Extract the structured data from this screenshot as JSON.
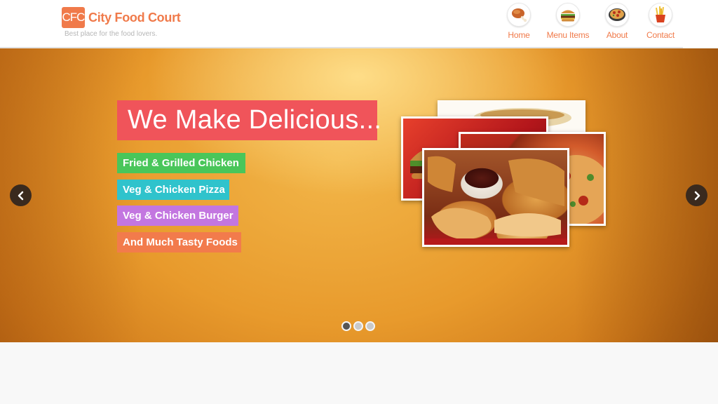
{
  "brand": {
    "logo_mark": "CFC",
    "name": "City Food Court",
    "tagline": "Best place for the food lovers."
  },
  "nav": {
    "items": [
      {
        "label": "Home",
        "icon": "chicken-leg-icon"
      },
      {
        "label": "Menu Items",
        "icon": "burger-icon"
      },
      {
        "label": "About",
        "icon": "pizza-icon"
      },
      {
        "label": "Contact",
        "icon": "fries-icon"
      }
    ]
  },
  "hero": {
    "headline": "We Make Delicious...",
    "tags": [
      "Fried & Grilled Chicken",
      "Veg & Chicken Pizza",
      "Veg & Chicken Burger",
      "And Much Tasty Foods"
    ],
    "slide_count": 3,
    "active_slide": 1
  },
  "colors": {
    "brand_orange": "#f07a4a",
    "headline_red": "#f0545a",
    "tag_green": "#49c65a",
    "tag_cyan": "#2fc3cc",
    "tag_purple": "#c376e0",
    "tag_orange": "#f27b4c"
  }
}
